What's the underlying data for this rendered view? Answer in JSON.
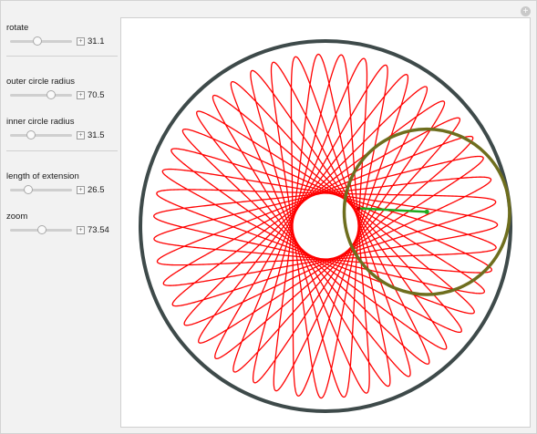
{
  "controls": [
    {
      "id": "rotate",
      "label": "rotate",
      "value": "31.1",
      "fraction": 0.44
    },
    {
      "id": "outer",
      "label": "outer circle radius",
      "value": "70.5",
      "fraction": 0.66
    },
    {
      "id": "inner",
      "label": "inner circle radius",
      "value": "31.5",
      "fraction": 0.34
    },
    {
      "id": "extension",
      "label": "length of extension",
      "value": "26.5",
      "fraction": 0.3
    },
    {
      "id": "zoom",
      "label": "zoom",
      "value": "73.54",
      "fraction": 0.52
    }
  ],
  "plot": {
    "R": 70.5,
    "r": 31.5,
    "d": 26.5,
    "rotate_deg": 31.1,
    "zoom": 73.54,
    "colors": {
      "boundary": "#3e4a4a",
      "curve": "#ff0000",
      "rolling_circle": "#6e6e1e",
      "arm": "#1faa1f",
      "pen": "#cc0000"
    }
  }
}
